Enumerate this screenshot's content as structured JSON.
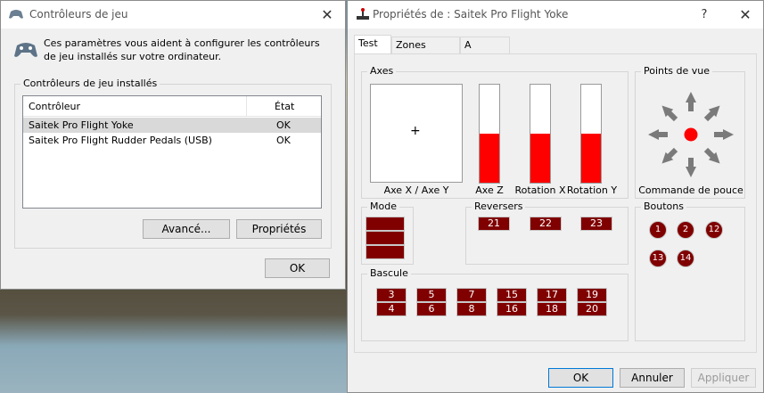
{
  "left_window": {
    "title": "Contrôleurs de jeu",
    "close": "✕",
    "description": "Ces paramètres vous aident à configurer les contrôleurs de jeu installés sur votre ordinateur.",
    "group_label": "Contrôleurs de jeu installés",
    "columns": [
      "Contrôleur",
      "État"
    ],
    "rows": [
      {
        "name": "Saitek Pro Flight Yoke",
        "status": "OK"
      },
      {
        "name": "Saitek Pro Flight Rudder Pedals (USB)",
        "status": "OK"
      }
    ],
    "advanced_label": "Avancé...",
    "properties_label": "Propriétés",
    "ok_label": "OK"
  },
  "right_window": {
    "title": "Propriétés de : Saitek Pro Flight Yoke",
    "help": "?",
    "close": "✕",
    "tabs": [
      "Test",
      "Zones mortes",
      "A propos"
    ],
    "axes": {
      "label": "Axes",
      "xy_label": "Axe X / Axe Y",
      "crosshair": "+",
      "bars": [
        {
          "label": "Axe Z",
          "level": 0.5
        },
        {
          "label": "Rotation X",
          "level": 0.5
        },
        {
          "label": "Rotation Y",
          "level": 0.5
        }
      ]
    },
    "pov": {
      "label": "Points de vue",
      "caption": "Commande de pouce"
    },
    "mode": {
      "label": "Mode"
    },
    "reversers": {
      "label": "Reversers",
      "buttons": [
        "21",
        "22",
        "23"
      ]
    },
    "boutons": {
      "label": "Boutons",
      "buttons": [
        "1",
        "2",
        "12",
        "13",
        "14"
      ]
    },
    "bascule": {
      "label": "Bascule",
      "top": [
        "3",
        "5",
        "7",
        "15",
        "17",
        "19"
      ],
      "bottom": [
        "4",
        "6",
        "8",
        "16",
        "18",
        "20"
      ]
    },
    "ok_label": "OK",
    "cancel_label": "Annuler",
    "apply_label": "Appliquer",
    "accent_color": "#ff0000",
    "button_color": "#800000"
  }
}
